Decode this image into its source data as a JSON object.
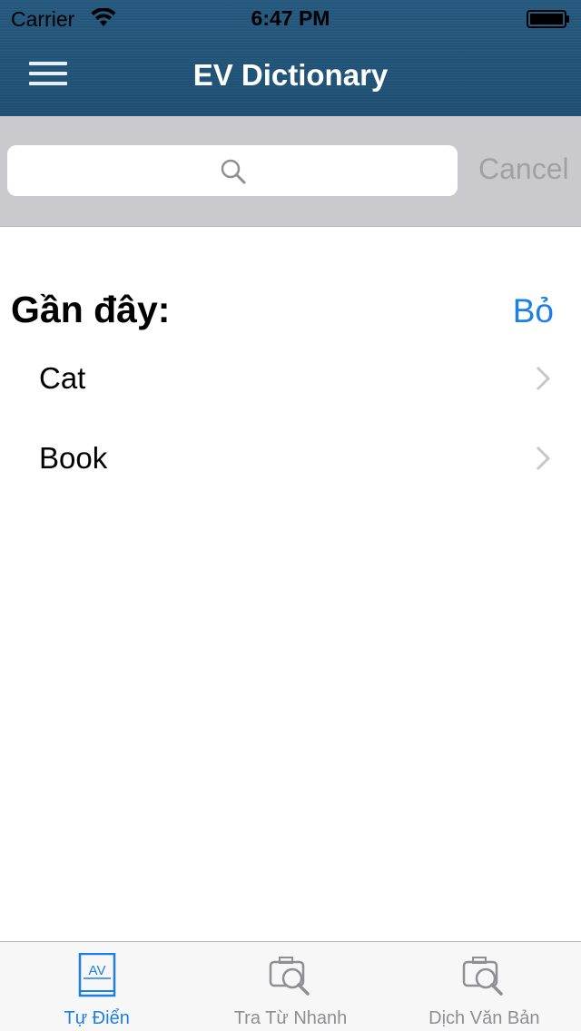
{
  "status_bar": {
    "carrier": "Carrier",
    "time": "6:47 PM",
    "icons": [
      "wifi-icon",
      "battery-icon"
    ]
  },
  "nav": {
    "title": "EV Dictionary",
    "menu_icon": "menu-icon"
  },
  "search": {
    "value": "",
    "icon": "search-icon",
    "cancel_label": "Cancel"
  },
  "recent": {
    "title": "Gần đây:",
    "clear_label": "Bỏ",
    "items": [
      {
        "label": "Cat"
      },
      {
        "label": "Book"
      }
    ]
  },
  "tab_bar": {
    "active_color": "#1d7ee8",
    "inactive_color": "#8e8e93",
    "tabs": [
      {
        "label": "Tự Điển",
        "icon": "dictionary-book-icon",
        "active": true
      },
      {
        "label": "Tra Từ Nhanh",
        "icon": "camera-search-icon",
        "active": false
      },
      {
        "label": "Dịch Văn Bản",
        "icon": "camera-search-icon",
        "active": false
      }
    ]
  },
  "colors": {
    "nav_background": "#235779",
    "search_bar_background": "#c9c9ce",
    "accent": "#1d7ee8"
  }
}
